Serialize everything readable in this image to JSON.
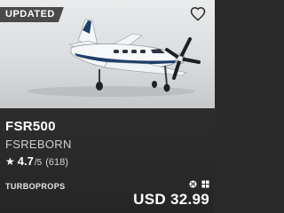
{
  "badge": {
    "label": "UPDATED"
  },
  "product": {
    "title": "FSR500",
    "publisher": "FSREBORN",
    "rating": {
      "score": "4.7",
      "out_of": "/5",
      "count": "(618)"
    },
    "category": "TURBOPROPS",
    "price": "USD 32.99"
  },
  "icons": {
    "wishlist": "heart-outline-icon",
    "star": "star-icon",
    "platform_xbox": "xbox-icon",
    "platform_pc": "windows-icon"
  },
  "colors": {
    "card_bg": "#2a2a2a",
    "badge_bg": "#4a4a4a",
    "text": "#ffffff",
    "aircraft_stripe": "#1d3e6b"
  }
}
